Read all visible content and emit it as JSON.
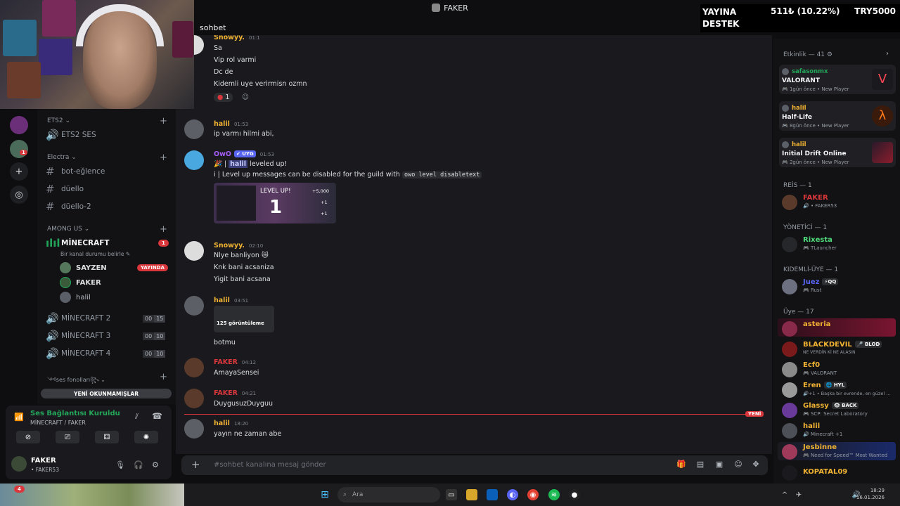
{
  "window": {
    "title": "FAKER"
  },
  "overlay": {
    "label": "YAYINA DESTEK",
    "amount": "511₺ (10.22%)",
    "goal": "TRY5000"
  },
  "chat": {
    "channel_name": "sohbet"
  },
  "servers": [
    {
      "icon": "server-avatar"
    },
    {
      "icon": "server-avatar"
    },
    {
      "icon": "plus-icon",
      "glyph": "+"
    },
    {
      "icon": "compass-icon",
      "glyph": "◎"
    }
  ],
  "channels": {
    "categories": [
      {
        "name": "ETS2",
        "label": "ETS2 ⌄"
      },
      {
        "name": "Electra",
        "label": "Electra ⌄"
      },
      {
        "name": "AMONG US",
        "label": "AMONG US ⌄"
      },
      {
        "name": "ses fonolları",
        "label": "༺ses fonolları꧂ ⌄"
      }
    ],
    "ets2_voice": "ETS2 SES",
    "text": [
      "bot-eğlence",
      "düello",
      "düello-2"
    ],
    "minecraft": {
      "name": "MİNECRAFT",
      "status": "Bir kanal durumu belirle ✎",
      "badge": "1"
    },
    "voice_users": [
      {
        "name": "SAYZEN",
        "badge": "YAYINDA"
      },
      {
        "name": "FAKER"
      },
      {
        "name": "halil"
      }
    ],
    "voice_channels": [
      {
        "name": "MİNECRAFT 2",
        "a": "00",
        "b": "15"
      },
      {
        "name": "MİNECRAFT 3",
        "a": "00",
        "b": "10"
      },
      {
        "name": "MİNECRAFT 4",
        "a": "00",
        "b": "10"
      }
    ],
    "unread_label": "YENİ OKUNMAMIŞLAR"
  },
  "voice_panel": {
    "status": "Ses Bağlantısı Kuruldu",
    "location": "MİNECRAFT / FAKER"
  },
  "user": {
    "name": "FAKER",
    "tag": "• FAKER53"
  },
  "messages": [
    {
      "author": "Snowyy.",
      "time": "01:1",
      "lines": [
        "Sa",
        "Vip rol varmi",
        "Dc de",
        "Kidemli uye verirmisn ozmn"
      ],
      "reaction": "1"
    },
    {
      "author": "halil",
      "time": "01:53",
      "lines": [
        "ip varmı hilmi abi,"
      ]
    },
    {
      "author": "OwO",
      "tag": "✔ UYG",
      "time": "01:53",
      "line1_prefix": "🎉 | ",
      "mention": "halil",
      "line1_suffix": " leveled up!",
      "line2": "i | Level up messages can be disabled for the guild with ",
      "code": "owo level disabletext",
      "card": {
        "title": "LEVEL UP!",
        "level": "1",
        "r1": "+5,000",
        "r2": "+1",
        "r3": "+1"
      }
    },
    {
      "author": "Snowyy.",
      "time": "02:10",
      "lines": [
        "Nlye banliyon 😿",
        "Knk bani acsaniza",
        "Yigit bani acsana"
      ]
    },
    {
      "author": "halil",
      "time": "03:51",
      "views": "125 görüntüleme",
      "lines": [
        "botmu"
      ]
    },
    {
      "author": "FAKER",
      "time": "04:12",
      "lines": [
        "AmayaSensei"
      ]
    },
    {
      "author": "FAKER",
      "time": "04:21",
      "lines": [
        "DuygusuzDuyguu"
      ]
    },
    {
      "author": "halil",
      "time": "18:20",
      "lines": [
        "yayın ne zaman  abe"
      ]
    }
  ],
  "new_label": "YENİ",
  "composer": {
    "placeholder": "#sohbet kanalına mesaj gönder"
  },
  "members": {
    "activity_header": "Etkinlik — 41 ⚙",
    "activities": [
      {
        "user": "safasonmx",
        "game": "VALORANT",
        "time": "🎮 1gün önce  •  New Player",
        "color": "#ff4655"
      },
      {
        "user": "halil",
        "game": "Half-Life",
        "time": "🎮 8gün önce  •  New Player",
        "color": "#c75b12"
      },
      {
        "user": "halil",
        "game": "Initial Drift Online",
        "time": "🎮 2gün önce  •  New Player",
        "color": "#8b1d2c"
      }
    ],
    "groups": [
      {
        "header": "REİS — 1",
        "members": [
          {
            "name": "FAKER",
            "status": "🔊 • FAKER53",
            "color": "#da373c"
          }
        ]
      },
      {
        "header": "YÖNETİCİ — 1",
        "members": [
          {
            "name": "Rixesta",
            "status": "🎮 TLauncher",
            "color": "#4fdc7c"
          }
        ]
      },
      {
        "header": "KIDEMLİ-ÜYE — 1",
        "members": [
          {
            "name": "Juez",
            "tag": "⚡QQ",
            "status": "🎮 Rust",
            "color": "#5865f2"
          }
        ]
      },
      {
        "header": "Üye — 17",
        "members": [
          {
            "name": "asteria",
            "status": "",
            "color": "#f0b232"
          },
          {
            "name": "BLACKDEVIL",
            "tag": "🎤 BLOD",
            "status": "NE VERDİN Kİ NE ALASIN",
            "color": "#f0b232"
          },
          {
            "name": "Ecf0",
            "status": "🎮 VALORANT",
            "color": "#f0b232"
          },
          {
            "name": "Eren",
            "tag": "🌐 HYL",
            "status": "🔊+1 • Başka bir evrende, en güzel ...",
            "color": "#f0b232"
          },
          {
            "name": "Glassy",
            "tag": "👁 BACK",
            "status": "🎮 SCP: Secret Laboratory",
            "color": "#f0b232"
          },
          {
            "name": "halil",
            "status": "🔊 Minecraft +1",
            "color": "#f0b232"
          },
          {
            "name": "Jesbinne",
            "status": "🎮 Need for Speed™ Most Wanted",
            "color": "#f0b232"
          },
          {
            "name": "KOPATAL09",
            "status": "",
            "color": "#f0b232"
          }
        ]
      }
    ]
  },
  "taskbar": {
    "search_placeholder": "Ara",
    "time": "18:29",
    "date": "16.01.2026",
    "app_badge": "4"
  }
}
